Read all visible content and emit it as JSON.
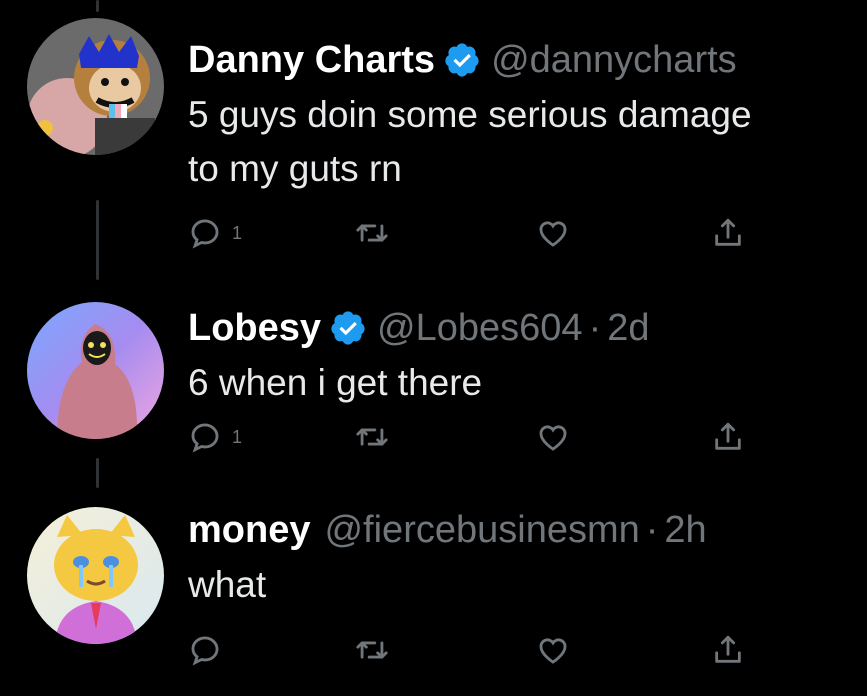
{
  "tweets": [
    {
      "name": "Danny Charts",
      "verified": true,
      "handle": "@dannycharts",
      "time": "",
      "text_lines": [
        "5 guys doin some serious damage",
        "to my guts rn"
      ],
      "reply_count": "1",
      "retweet_count": "",
      "like_count": ""
    },
    {
      "name": "Lobesy",
      "verified": true,
      "handle": "@Lobes604",
      "time": "2d",
      "text_lines": [
        "6 when i get there"
      ],
      "reply_count": "1",
      "retweet_count": "",
      "like_count": ""
    },
    {
      "name": "money",
      "verified": false,
      "handle": "@fiercebusinesmn",
      "time": "2h",
      "text_lines": [
        "what"
      ],
      "reply_count": "",
      "retweet_count": "",
      "like_count": ""
    }
  ],
  "separator": "·",
  "colors": {
    "background": "#000000",
    "text": "#e7e9ea",
    "secondary": "#71767b",
    "verified": "#1d9bf0",
    "thread_line": "#2f3336"
  },
  "icons": [
    "reply-icon",
    "retweet-icon",
    "like-icon",
    "share-icon",
    "verified-icon"
  ]
}
